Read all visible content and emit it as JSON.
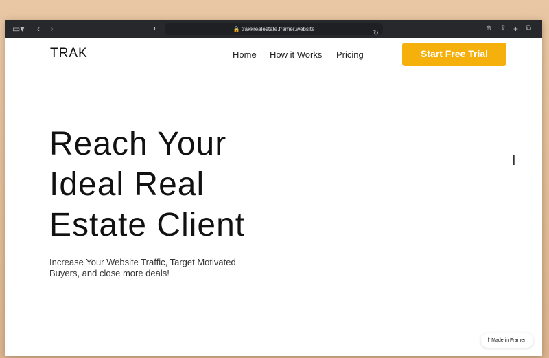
{
  "browser": {
    "url": "trakkrealestate.framer.website"
  },
  "site": {
    "logo": "TRAK",
    "nav": [
      "Home",
      "How it Works",
      "Pricing"
    ],
    "cta": "Start Free Trial"
  },
  "hero": {
    "title": "Reach Your Ideal Real Estate Client",
    "subtitle": "Increase Your Website Traffic, Target Motivated Buyers, and close more deals!"
  },
  "badge": {
    "label": "Made in Framer"
  },
  "colors": {
    "accent": "#f5b00c"
  }
}
